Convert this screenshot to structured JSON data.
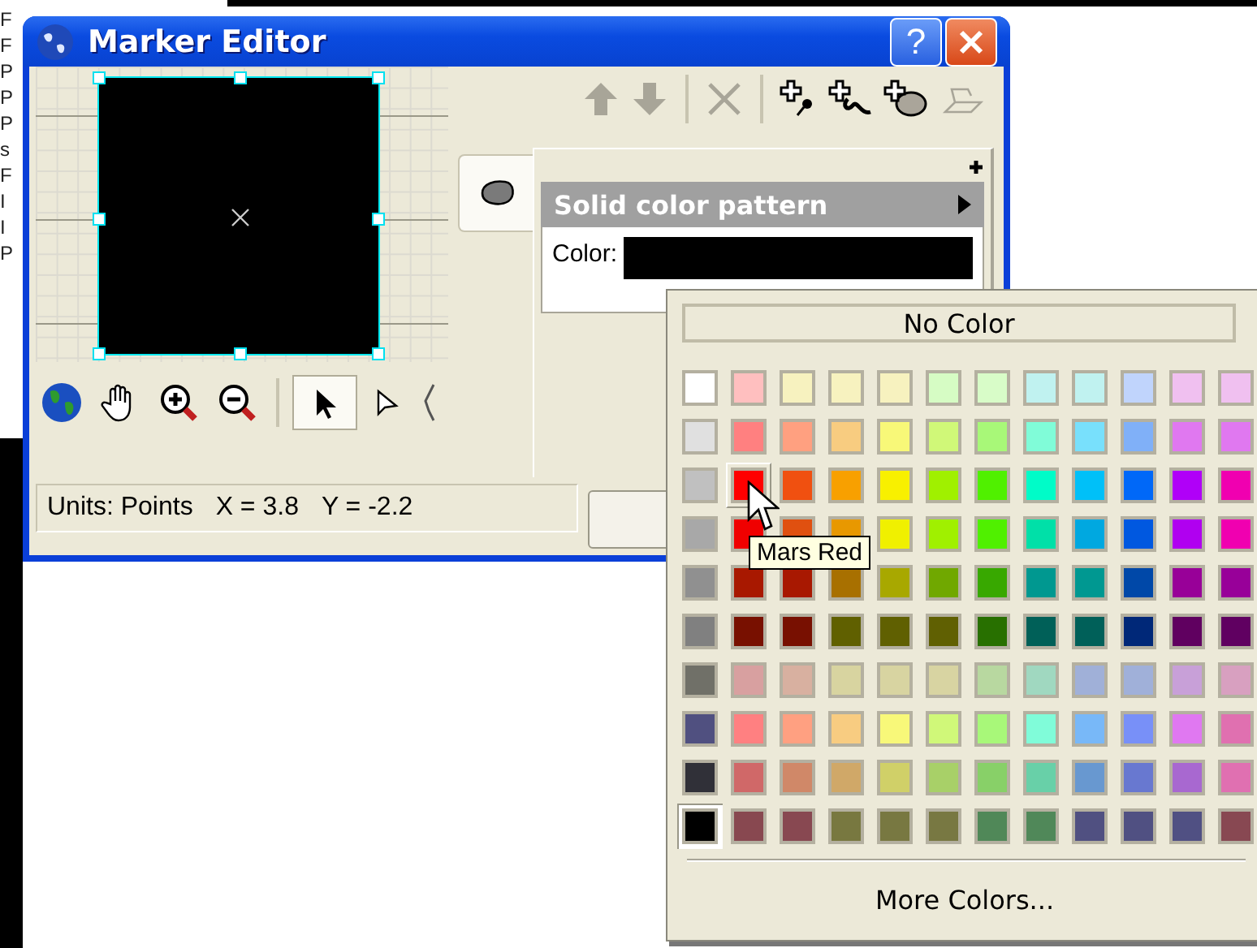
{
  "left_fragments": [
    "F",
    "F",
    "P",
    "P",
    "P",
    "s",
    "F",
    "I",
    "I",
    "P"
  ],
  "window": {
    "title": "Marker Editor",
    "help": "?"
  },
  "toolbar": [
    {
      "kind": "up",
      "disabled": true
    },
    {
      "kind": "down",
      "disabled": true
    },
    {
      "kind": "delete",
      "disabled": true
    },
    {
      "kind": "add-point",
      "disabled": false
    },
    {
      "kind": "add-path",
      "disabled": false
    },
    {
      "kind": "add-shape",
      "disabled": false
    },
    {
      "kind": "fold",
      "disabled": true
    }
  ],
  "tools": [
    {
      "kind": "globe",
      "selected": false
    },
    {
      "kind": "hand",
      "selected": false
    },
    {
      "kind": "zoom-in",
      "selected": false
    },
    {
      "kind": "zoom-out",
      "selected": false
    },
    {
      "kind": "arrow",
      "selected": true
    },
    {
      "kind": "hollow-arrow",
      "selected": false
    },
    {
      "kind": "pen",
      "selected": false
    }
  ],
  "tabs": [
    {
      "kind": "shape",
      "selected": true
    }
  ],
  "pattern": {
    "title": "Solid color pattern",
    "color_label": "Color:"
  },
  "status": {
    "units": "Units: Points",
    "x": "X = 3.8",
    "y": "Y = -2.2"
  },
  "palette": {
    "no_color": "No Color",
    "more_colors": "More Colors...",
    "tooltip": "Mars Red",
    "rows": [
      [
        {
          "color": "#ffffff",
          "selected": false,
          "hovered": false
        },
        {
          "color": "#ffbfbf",
          "selected": false,
          "hovered": false
        },
        {
          "color": "#f7f2bf",
          "selected": false,
          "hovered": false
        },
        {
          "color": "#f7f2bf",
          "selected": false,
          "hovered": false
        },
        {
          "color": "#f7f2bf",
          "selected": false,
          "hovered": false
        },
        {
          "color": "#d6fcc4",
          "selected": false,
          "hovered": false
        },
        {
          "color": "#d8fcc8",
          "selected": false,
          "hovered": false
        },
        {
          "color": "#c0f2f0",
          "selected": false,
          "hovered": false
        },
        {
          "color": "#c0f2f0",
          "selected": false,
          "hovered": false
        },
        {
          "color": "#c0d4fc",
          "selected": false,
          "hovered": false
        },
        {
          "color": "#f0c0f0",
          "selected": false,
          "hovered": false
        },
        {
          "color": "#f0c0f0",
          "selected": false,
          "hovered": false
        }
      ],
      [
        {
          "color": "#e0e0e0",
          "selected": false,
          "hovered": false
        },
        {
          "color": "#ff8080",
          "selected": false,
          "hovered": false
        },
        {
          "color": "#ffa080",
          "selected": false,
          "hovered": false
        },
        {
          "color": "#f8cc80",
          "selected": false,
          "hovered": false
        },
        {
          "color": "#f8f878",
          "selected": false,
          "hovered": false
        },
        {
          "color": "#d0f878",
          "selected": false,
          "hovered": false
        },
        {
          "color": "#a8f878",
          "selected": false,
          "hovered": false
        },
        {
          "color": "#80fcd8",
          "selected": false,
          "hovered": false
        },
        {
          "color": "#78e0fc",
          "selected": false,
          "hovered": false
        },
        {
          "color": "#80b0f8",
          "selected": false,
          "hovered": false
        },
        {
          "color": "#e078f0",
          "selected": false,
          "hovered": false
        },
        {
          "color": "#e078f0",
          "selected": false,
          "hovered": false
        }
      ],
      [
        {
          "color": "#c0c0c0",
          "selected": false,
          "hovered": false
        },
        {
          "color": "#ff0000",
          "selected": false,
          "hovered": true
        },
        {
          "color": "#f05010",
          "selected": false,
          "hovered": false
        },
        {
          "color": "#f8a000",
          "selected": false,
          "hovered": false
        },
        {
          "color": "#f8f000",
          "selected": false,
          "hovered": false
        },
        {
          "color": "#a0f000",
          "selected": false,
          "hovered": false
        },
        {
          "color": "#50f000",
          "selected": false,
          "hovered": false
        },
        {
          "color": "#00fcc8",
          "selected": false,
          "hovered": false
        },
        {
          "color": "#00c0f8",
          "selected": false,
          "hovered": false
        },
        {
          "color": "#0068f8",
          "selected": false,
          "hovered": false
        },
        {
          "color": "#b000f8",
          "selected": false,
          "hovered": false
        },
        {
          "color": "#f000b0",
          "selected": false,
          "hovered": false
        }
      ],
      [
        {
          "color": "#a8a8a8",
          "selected": false,
          "hovered": false
        },
        {
          "color": "#f00000",
          "selected": false,
          "hovered": false
        },
        {
          "color": "#e05010",
          "selected": false,
          "hovered": false
        },
        {
          "color": "#e89800",
          "selected": false,
          "hovered": false
        },
        {
          "color": "#f0f000",
          "selected": false,
          "hovered": false
        },
        {
          "color": "#a0f000",
          "selected": false,
          "hovered": false
        },
        {
          "color": "#50f000",
          "selected": false,
          "hovered": false
        },
        {
          "color": "#00e0a8",
          "selected": false,
          "hovered": false
        },
        {
          "color": "#00a8e0",
          "selected": false,
          "hovered": false
        },
        {
          "color": "#0058e0",
          "selected": false,
          "hovered": false
        },
        {
          "color": "#b000f0",
          "selected": false,
          "hovered": false
        },
        {
          "color": "#f000b0",
          "selected": false,
          "hovered": false
        }
      ],
      [
        {
          "color": "#909090",
          "selected": false,
          "hovered": false
        },
        {
          "color": "#a81800",
          "selected": false,
          "hovered": false
        },
        {
          "color": "#a81801",
          "selected": false,
          "hovered": false
        },
        {
          "color": "#a87000",
          "selected": false,
          "hovered": false
        },
        {
          "color": "#a8a800",
          "selected": false,
          "hovered": false
        },
        {
          "color": "#70a800",
          "selected": false,
          "hovered": false
        },
        {
          "color": "#38a800",
          "selected": false,
          "hovered": false
        },
        {
          "color": "#009890",
          "selected": false,
          "hovered": false
        },
        {
          "color": "#009891",
          "selected": false,
          "hovered": false
        },
        {
          "color": "#0048a8",
          "selected": false,
          "hovered": false
        },
        {
          "color": "#980098",
          "selected": false,
          "hovered": false
        },
        {
          "color": "#980099",
          "selected": false,
          "hovered": false
        }
      ],
      [
        {
          "color": "#808080",
          "selected": false,
          "hovered": false
        },
        {
          "color": "#781000",
          "selected": false,
          "hovered": false
        },
        {
          "color": "#781001",
          "selected": false,
          "hovered": false
        },
        {
          "color": "#606000",
          "selected": false,
          "hovered": false
        },
        {
          "color": "#606001",
          "selected": false,
          "hovered": false
        },
        {
          "color": "#606002",
          "selected": false,
          "hovered": false
        },
        {
          "color": "#287000",
          "selected": false,
          "hovered": false
        },
        {
          "color": "#006058",
          "selected": false,
          "hovered": false
        },
        {
          "color": "#006059",
          "selected": false,
          "hovered": false
        },
        {
          "color": "#002878",
          "selected": false,
          "hovered": false
        },
        {
          "color": "#600060",
          "selected": false,
          "hovered": false
        },
        {
          "color": "#600061",
          "selected": false,
          "hovered": false
        }
      ],
      [
        {
          "color": "#707068",
          "selected": false,
          "hovered": false
        },
        {
          "color": "#d8a0a0",
          "selected": false,
          "hovered": false
        },
        {
          "color": "#d8b0a0",
          "selected": false,
          "hovered": false
        },
        {
          "color": "#d8d4a0",
          "selected": false,
          "hovered": false
        },
        {
          "color": "#d8d4a1",
          "selected": false,
          "hovered": false
        },
        {
          "color": "#d8d4a2",
          "selected": false,
          "hovered": false
        },
        {
          "color": "#b8d8a0",
          "selected": false,
          "hovered": false
        },
        {
          "color": "#a0d8c0",
          "selected": false,
          "hovered": false
        },
        {
          "color": "#a0b0d8",
          "selected": false,
          "hovered": false
        },
        {
          "color": "#a0b0d9",
          "selected": false,
          "hovered": false
        },
        {
          "color": "#c8a0d8",
          "selected": false,
          "hovered": false
        },
        {
          "color": "#d8a0c0",
          "selected": false,
          "hovered": false
        }
      ],
      [
        {
          "color": "#505080",
          "selected": false,
          "hovered": false
        },
        {
          "color": "#ff8081",
          "selected": false,
          "hovered": false
        },
        {
          "color": "#ffa081",
          "selected": false,
          "hovered": false
        },
        {
          "color": "#f8cc81",
          "selected": false,
          "hovered": false
        },
        {
          "color": "#f8f879",
          "selected": false,
          "hovered": false
        },
        {
          "color": "#d0f879",
          "selected": false,
          "hovered": false
        },
        {
          "color": "#a8f879",
          "selected": false,
          "hovered": false
        },
        {
          "color": "#80fcd9",
          "selected": false,
          "hovered": false
        },
        {
          "color": "#78b8f8",
          "selected": false,
          "hovered": false
        },
        {
          "color": "#7890f8",
          "selected": false,
          "hovered": false
        },
        {
          "color": "#e078f1",
          "selected": false,
          "hovered": false
        },
        {
          "color": "#e070b0",
          "selected": false,
          "hovered": false
        }
      ],
      [
        {
          "color": "#303038",
          "selected": false,
          "hovered": false
        },
        {
          "color": "#d06868",
          "selected": false,
          "hovered": false
        },
        {
          "color": "#d08868",
          "selected": false,
          "hovered": false
        },
        {
          "color": "#d0a868",
          "selected": false,
          "hovered": false
        },
        {
          "color": "#d0d068",
          "selected": false,
          "hovered": false
        },
        {
          "color": "#a8d068",
          "selected": false,
          "hovered": false
        },
        {
          "color": "#88d068",
          "selected": false,
          "hovered": false
        },
        {
          "color": "#68d0a8",
          "selected": false,
          "hovered": false
        },
        {
          "color": "#6898d0",
          "selected": false,
          "hovered": false
        },
        {
          "color": "#6878d0",
          "selected": false,
          "hovered": false
        },
        {
          "color": "#a868d0",
          "selected": false,
          "hovered": false
        },
        {
          "color": "#e070b1",
          "selected": false,
          "hovered": false
        }
      ],
      [
        {
          "color": "#000000",
          "selected": true,
          "hovered": false
        },
        {
          "color": "#884850",
          "selected": false,
          "hovered": false
        },
        {
          "color": "#884851",
          "selected": false,
          "hovered": false
        },
        {
          "color": "#787840",
          "selected": false,
          "hovered": false
        },
        {
          "color": "#787841",
          "selected": false,
          "hovered": false
        },
        {
          "color": "#787842",
          "selected": false,
          "hovered": false
        },
        {
          "color": "#508858",
          "selected": false,
          "hovered": false
        },
        {
          "color": "#508859",
          "selected": false,
          "hovered": false
        },
        {
          "color": "#505081",
          "selected": false,
          "hovered": false
        },
        {
          "color": "#505082",
          "selected": false,
          "hovered": false
        },
        {
          "color": "#505083",
          "selected": false,
          "hovered": false
        },
        {
          "color": "#884852",
          "selected": false,
          "hovered": false
        }
      ]
    ]
  }
}
